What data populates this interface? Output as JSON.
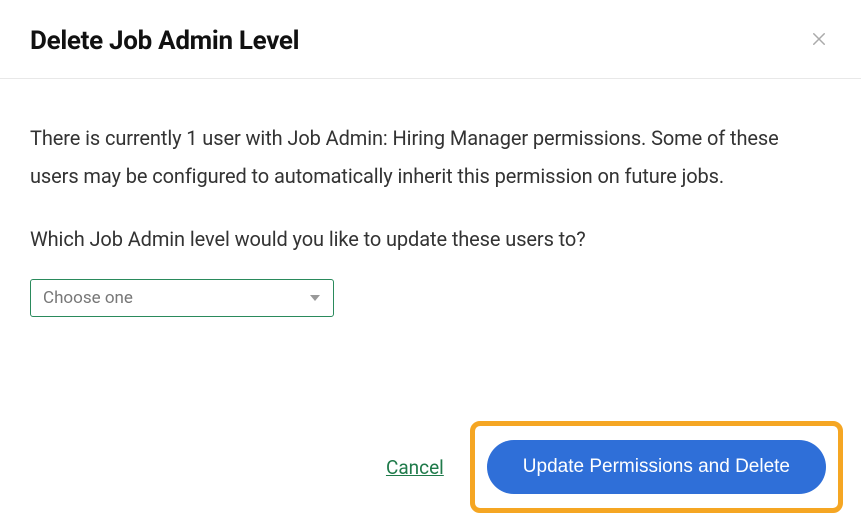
{
  "modal": {
    "title": "Delete Job Admin Level",
    "body_text": "There is currently 1 user with Job Admin: Hiring Manager permissions. Some of these users may be configured to automatically inherit this permission on future jobs.",
    "prompt_text": "Which Job Admin level would you like to update these users to?",
    "select": {
      "placeholder": "Choose one"
    },
    "cancel_label": "Cancel",
    "confirm_label": "Update Permissions and Delete"
  }
}
